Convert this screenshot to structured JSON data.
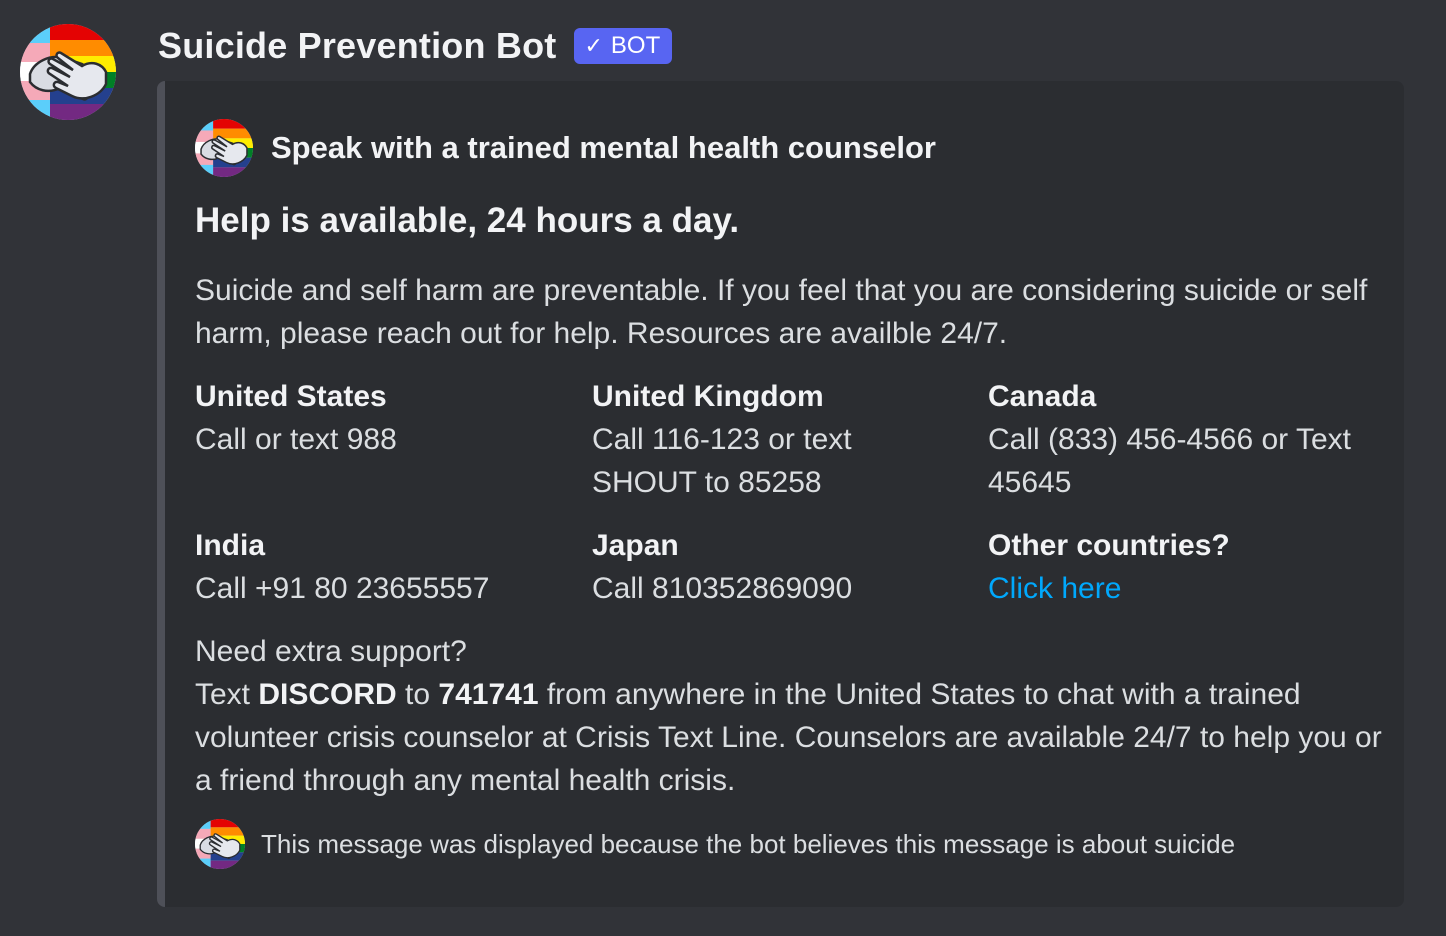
{
  "message": {
    "username": "Suicide Prevention Bot",
    "bot_tag": {
      "check": "✓",
      "label": "BOT"
    }
  },
  "embed": {
    "author": "Speak with a trained mental health counselor",
    "title": "Help is available, 24 hours a day.",
    "description": "Suicide and self harm are preventable. If you feel that you are considering suicide or self harm, please reach out for help. Resources are availble 24/7.",
    "fields": [
      {
        "name": "United States",
        "value": "Call or text 988"
      },
      {
        "name": "United Kingdom",
        "value": "Call 116-123 or text SHOUT to 85258"
      },
      {
        "name": "Canada",
        "value": "Call (833) 456-4566 or Text 45645"
      },
      {
        "name": "India",
        "value": "Call +91 80 23655557"
      },
      {
        "name": "Japan",
        "value": "Call 810352869090"
      },
      {
        "name": "Other countries?",
        "value": "Click here"
      }
    ],
    "extra": {
      "heading": "Need extra support?",
      "text_prefix": "Text ",
      "keyword": "DISCORD",
      "text_to": " to ",
      "number": "741741",
      "text_rest": " from anywhere in the United States to chat with a trained volunteer crisis counselor at Crisis Text Line. Counselors are available 24/7 to help you or a friend through any mental health crisis."
    },
    "footer": "This message was displayed because the bot believes this message is about suicide"
  },
  "colors": {
    "background": "#313338",
    "embed_background": "#2b2d31",
    "embed_border": "#4e5058",
    "bot_tag": "#5865f2",
    "link": "#00a8fc"
  },
  "icons": {
    "avatar": "helping-hands-pride-icon"
  }
}
